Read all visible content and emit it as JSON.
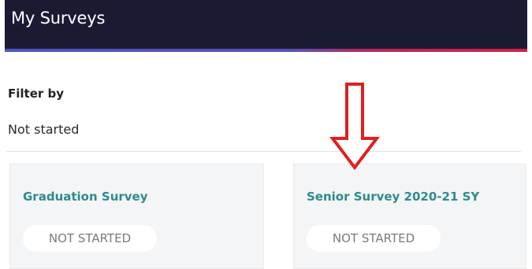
{
  "header": {
    "title": "My Surveys"
  },
  "filter": {
    "label": "Filter by",
    "value": "Not started"
  },
  "surveys": [
    {
      "title": "Graduation Survey",
      "status": "NOT STARTED"
    },
    {
      "title": "Senior Survey 2020-21 SY",
      "status": "NOT STARTED"
    }
  ],
  "colors": {
    "header_bg": "#1a1b33",
    "accent_blue": "#4d56c0",
    "accent_red": "#d21f48",
    "survey_title": "#2f8a8e",
    "annotation_arrow": "#e02020"
  },
  "icons": {
    "annotation": "down-arrow-icon"
  }
}
